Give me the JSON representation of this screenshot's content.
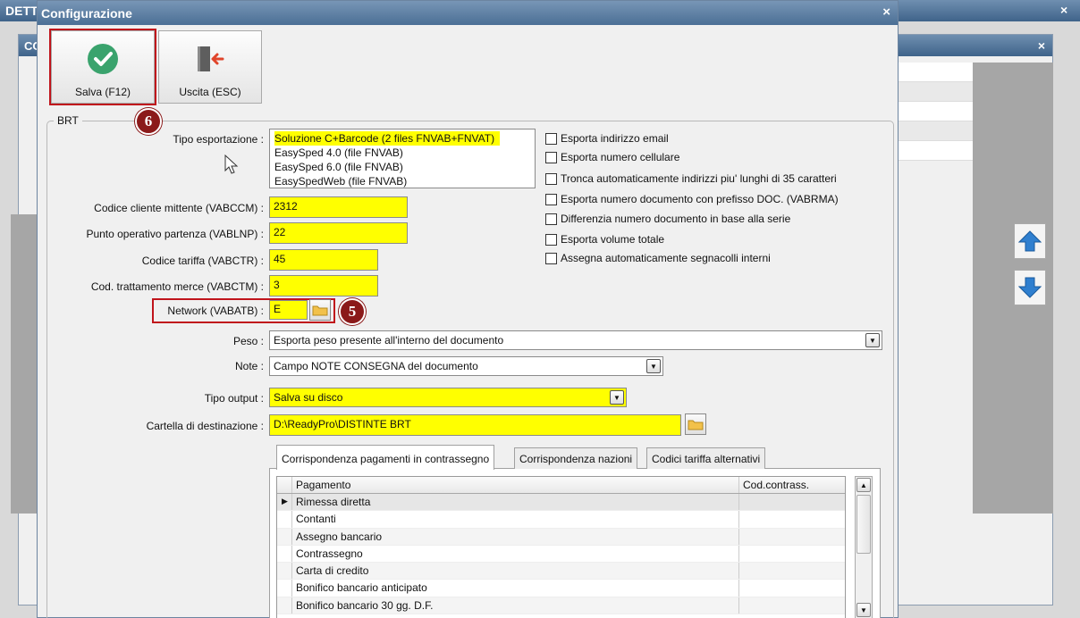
{
  "background": {
    "outer_title": "DETT",
    "inner_title": "CO"
  },
  "dialog": {
    "title": "Configurazione",
    "close_glyph": "×"
  },
  "toolbar": {
    "save_label": "Salva (F12)",
    "exit_label": "Uscita (ESC)"
  },
  "badges": {
    "save": "6",
    "network": "5"
  },
  "group": {
    "legend": "BRT"
  },
  "form": {
    "tipo_esportazione": {
      "label": "Tipo esportazione :",
      "options": [
        "Soluzione C+Barcode (2 files FNVAB+FNVAT)",
        "EasySped 4.0 (file FNVAB)",
        "EasySped 6.0 (file FNVAB)",
        "EasySpedWeb (file FNVAB)"
      ]
    },
    "codice_cliente": {
      "label": "Codice cliente mittente (VABCCM) :",
      "value": "2312"
    },
    "punto_operativo": {
      "label": "Punto operativo partenza (VABLNP) :",
      "value": "22"
    },
    "codice_tariffa": {
      "label": "Codice tariffa (VABCTR) :",
      "value": "45"
    },
    "cod_trattamento": {
      "label": "Cod. trattamento merce (VABCTM) :",
      "value": "3"
    },
    "network": {
      "label": "Network (VABATB) :",
      "value": "E"
    },
    "peso": {
      "label": "Peso :",
      "value": "Esporta peso presente all'interno del documento"
    },
    "note": {
      "label": "Note :",
      "value": "Campo NOTE CONSEGNA del documento"
    },
    "tipo_output": {
      "label": "Tipo output :",
      "value": "Salva su disco"
    },
    "cartella": {
      "label": "Cartella di destinazione :",
      "value": "D:\\ReadyPro\\DISTINTE BRT"
    }
  },
  "checkboxes": [
    "Esporta indirizzo email",
    "Esporta numero cellulare",
    "Tronca automaticamente indirizzi piu' lunghi di 35 caratteri",
    "Esporta numero documento con prefisso DOC. (VABRMA)",
    "Differenzia numero documento in base alla serie",
    "Esporta volume totale",
    "Assegna automaticamente segnacolli interni"
  ],
  "tabs": [
    "Corrispondenza pagamenti in contrassegno",
    "Corrispondenza nazioni",
    "Codici tariffa alternativi"
  ],
  "grid": {
    "columns": [
      "Pagamento",
      "Cod.contrass."
    ],
    "rows": [
      "Rimessa diretta",
      "Contanti",
      "Assegno bancario",
      "Contrassegno",
      "Carta di credito",
      "Bonifico bancario anticipato",
      "Bonifico bancario 30 gg. D.F."
    ]
  },
  "colors": {
    "highlight": "#ffff00",
    "annotation_red": "#c0141b",
    "badge": "#8b1a1a",
    "title_bar": "#4b6f95"
  }
}
